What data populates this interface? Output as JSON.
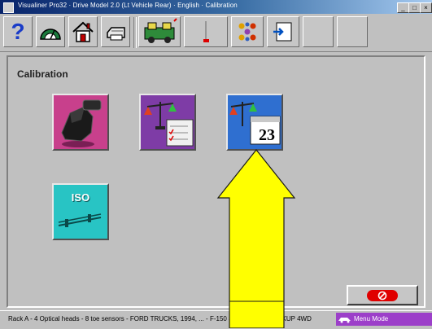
{
  "window": {
    "title": "Visualiner Pro32 · Drive Model 2.0 (Lt Vehicle Rear) · English · Calibration",
    "minimize": "_",
    "maximize": "□",
    "close": "×"
  },
  "toolbar": {
    "help_glyph": "?",
    "items": [
      "help-icon",
      "alignment-icon",
      "home-icon",
      "printer-icon",
      "vehicle-specs-icon",
      "vehicle-measurement-icon",
      "wheel-adjust-icon",
      "program-options-icon",
      "exit-to-icon"
    ]
  },
  "panel": {
    "title": "Calibration"
  },
  "tiles": {
    "date_day": "23",
    "iso_label": "ISO"
  },
  "statusbar": {
    "text": "Rack A - 4 Optical heads - 8 toe sensors - FORD TRUCKS, 1994, ... - F-150 4WD 1/2 TON PICKUP 4WD",
    "mode": "Menu Mode"
  },
  "colors": {
    "accent_yellow": "#ffff00",
    "mode_purple": "#9c3fc9",
    "exit_red": "#e00000"
  }
}
